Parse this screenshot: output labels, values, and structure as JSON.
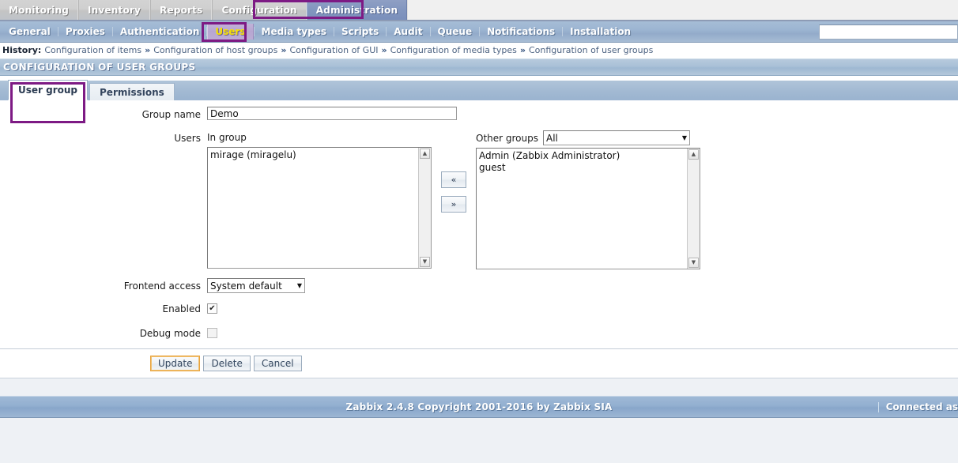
{
  "topmenu": {
    "items": [
      {
        "label": "Monitoring",
        "active": false
      },
      {
        "label": "Inventory",
        "active": false
      },
      {
        "label": "Reports",
        "active": false
      },
      {
        "label": "Configuration",
        "active": false
      },
      {
        "label": "Administration",
        "active": true
      }
    ]
  },
  "submenu": {
    "items": [
      {
        "label": "General",
        "selected": false
      },
      {
        "label": "Proxies",
        "selected": false
      },
      {
        "label": "Authentication",
        "selected": false
      },
      {
        "label": "Users",
        "selected": true
      },
      {
        "label": "Media types",
        "selected": false
      },
      {
        "label": "Scripts",
        "selected": false
      },
      {
        "label": "Audit",
        "selected": false
      },
      {
        "label": "Queue",
        "selected": false
      },
      {
        "label": "Notifications",
        "selected": false
      },
      {
        "label": "Installation",
        "selected": false
      }
    ],
    "search": {
      "value": "",
      "placeholder": ""
    }
  },
  "history": {
    "label": "History:",
    "separator": "»",
    "items": [
      "Configuration of items",
      "Configuration of host groups",
      "Configuration of GUI",
      "Configuration of media types",
      "Configuration of user groups"
    ]
  },
  "page": {
    "title": "CONFIGURATION OF USER GROUPS"
  },
  "tabs": [
    {
      "label": "User group",
      "active": true
    },
    {
      "label": "Permissions",
      "active": false
    }
  ],
  "form": {
    "group_name": {
      "label": "Group name",
      "value": "Demo",
      "placeholder": ""
    },
    "users": {
      "label": "Users",
      "in_group_label": "In group",
      "in_group_items": [
        "mirage (miragelu)"
      ],
      "other_groups_label": "Other groups",
      "other_groups_filter": "All",
      "other_groups_items": [
        "Admin (Zabbix Administrator)",
        "guest"
      ],
      "move_left_label": "«",
      "move_right_label": "»"
    },
    "frontend_access": {
      "label": "Frontend access",
      "value": "System default"
    },
    "enabled": {
      "label": "Enabled",
      "checked": true,
      "mark": "✔"
    },
    "debug_mode": {
      "label": "Debug mode",
      "checked": false,
      "mark": ""
    }
  },
  "actions": {
    "update_label": "Update",
    "delete_label": "Delete",
    "cancel_label": "Cancel"
  },
  "footer": {
    "copyright": "Zabbix 2.4.8 Copyright 2001-2016 by Zabbix SIA",
    "connected_as": "Connected as"
  },
  "colors": {
    "highlight_box": "#7d1a84",
    "selected_menu_text": "#f5e000",
    "focus_border": "#e8a33d"
  },
  "icons": {
    "scroll_up": "▲",
    "scroll_down": "▼",
    "caret_down": "▼"
  }
}
